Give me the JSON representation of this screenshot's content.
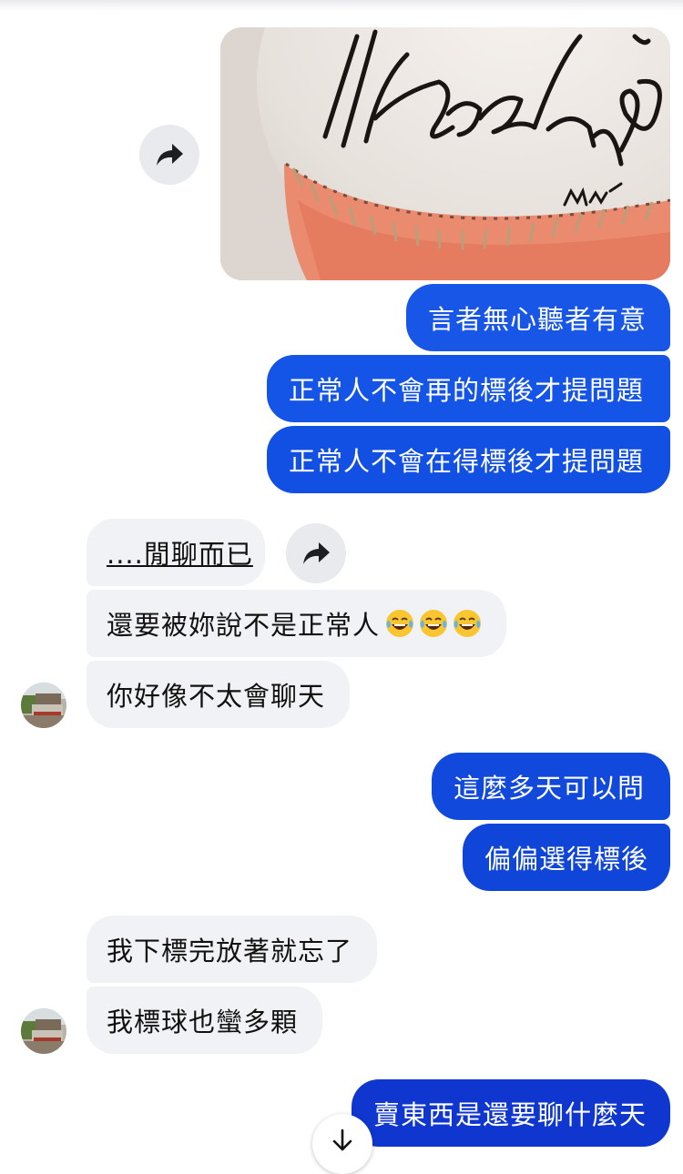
{
  "conversation": {
    "outgoing_block_1": [
      "言者無心聽者有意",
      "正常人不會再的標後才提問題",
      "正常人不會在得標後才提問題"
    ],
    "incoming_block_1": [
      "....閒聊而已",
      "還要被妳說不是正常人",
      "你好像不太會聊天"
    ],
    "outgoing_block_2": [
      "這麼多天可以問",
      "偏偏選得標後"
    ],
    "incoming_block_2": [
      "我下標完放著就忘了",
      "我標球也蠻多顆"
    ],
    "outgoing_block_3": [
      "賣東西是還要聊什麼天"
    ]
  },
  "icons": {
    "share": "share-arrow-icon",
    "scroll": "arrow-down-icon",
    "emoji": "face-with-tears-of-joy-icon"
  },
  "colors": {
    "outgoing_bubble_1": "#1756e6",
    "outgoing_bubble_2": "#1149dc",
    "outgoing_bubble_3": "#0f36cf",
    "incoming_bubble": "#f0f2f5",
    "share_button": "#e8eaee"
  }
}
